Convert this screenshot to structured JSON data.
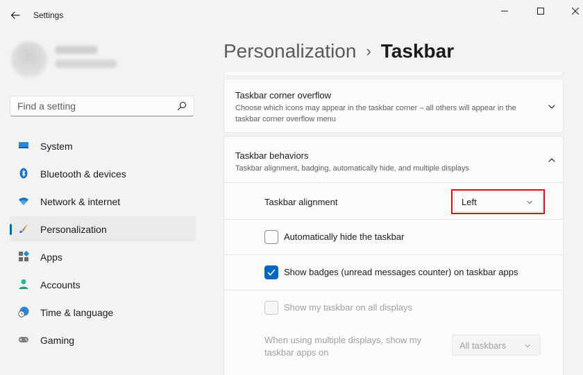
{
  "window": {
    "title": "Settings"
  },
  "search": {
    "placeholder": "Find a setting"
  },
  "nav": {
    "items": [
      {
        "label": "System",
        "icon": "system-icon"
      },
      {
        "label": "Bluetooth & devices",
        "icon": "bluetooth-icon"
      },
      {
        "label": "Network & internet",
        "icon": "wifi-icon"
      },
      {
        "label": "Personalization",
        "icon": "brush-icon",
        "active": true
      },
      {
        "label": "Apps",
        "icon": "apps-icon"
      },
      {
        "label": "Accounts",
        "icon": "person-icon"
      },
      {
        "label": "Time & language",
        "icon": "clock-globe-icon"
      },
      {
        "label": "Gaming",
        "icon": "gamepad-icon"
      }
    ]
  },
  "breadcrumb": {
    "parent": "Personalization",
    "separator": "›",
    "current": "Taskbar"
  },
  "overflow_card": {
    "title": "Taskbar corner overflow",
    "description": "Choose which icons may appear in the taskbar corner – all others will appear in the taskbar corner overflow menu"
  },
  "behaviors": {
    "title": "Taskbar behaviors",
    "description": "Taskbar alignment, badging, automatically hide, and multiple displays",
    "alignment": {
      "label": "Taskbar alignment",
      "value": "Left"
    },
    "auto_hide": {
      "label": "Automatically hide the taskbar",
      "checked": false
    },
    "badges": {
      "label": "Show badges (unread messages counter) on taskbar apps",
      "checked": true
    },
    "all_displays": {
      "label": "Show my taskbar on all displays",
      "checked": false,
      "disabled": true
    },
    "multi_display": {
      "label": "When using multiple displays, show my taskbar apps on",
      "value": "All taskbars",
      "disabled": true
    }
  },
  "colors": {
    "accent": "#0067c0",
    "highlight": "#d0121b",
    "background": "#f3f3f3",
    "card": "#fbfbfb"
  }
}
